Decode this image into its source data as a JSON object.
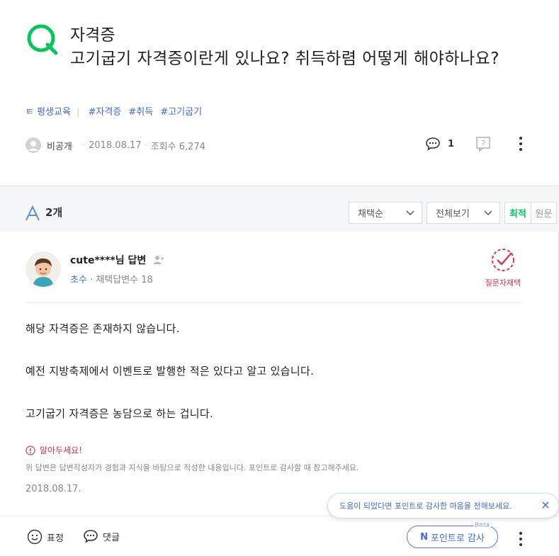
{
  "question": {
    "category": "자격증",
    "title": "고기굽기 자격증이란게 있나요? 취득하렴 어떻게 해야하나요?",
    "tags": [
      "ㅌ 평생교육",
      "#자격증",
      "#취득",
      "#고기굽기"
    ],
    "author": "비공개",
    "date": "2018.08.17",
    "views_label": "조회수 6,274",
    "comment_count": "1"
  },
  "answers_header": {
    "count_label": "2개",
    "sort_selected": "채택순",
    "filter_selected": "전체보기",
    "toggle_latest": "최적",
    "toggle_original": "원문"
  },
  "answer": {
    "author": "cute****님 답변",
    "level": "초수",
    "chosen_count_label": "채택답변수 18",
    "badge_label": "질문자채택",
    "body": [
      "해당 자격증은 존재하지 않습니다.",
      "예전 지방축제에서 이벤트로 발행한 적은 있다고 알고 있습니다.",
      "고기굽기 자격증은 농담으로 하는 겁니다."
    ],
    "notice_title": "알아두세요!",
    "notice_text": "위 답변은 답변작성자가 경험과 지식을 바탕으로 작성한 내용입니다. 포인트로 감사할 때 참고해주세요.",
    "date": "2018.08.17."
  },
  "bottom_bar": {
    "reaction_label": "표정",
    "comment_label": "댓글",
    "tooltip_text": "도움이 되었다면 포인트로 감사한 마음을 전해보세요.",
    "points_button_label": "포인트로 감사",
    "points_button_glyph": "N",
    "beta_label": "Beta"
  },
  "colors": {
    "brand_green": "#03c75a",
    "link_blue": "#3f6bd6",
    "alert_red": "#e0334a"
  }
}
